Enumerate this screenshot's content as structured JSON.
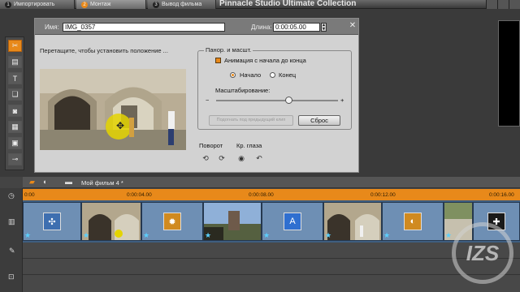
{
  "steps": [
    {
      "num": "1",
      "label": "Импортировать"
    },
    {
      "num": "2",
      "label": "Монтаж"
    },
    {
      "num": "3",
      "label": "Вывод фильма"
    }
  ],
  "app_title": "Pinnacle Studio Ultimate Collection",
  "tools": [
    "scissors-icon",
    "titles-icon",
    "text-icon",
    "effects-icon",
    "camera-icon",
    "clapper-icon",
    "music-icon",
    "plug-icon"
  ],
  "panel": {
    "name_label": "Имя:",
    "name_value": "IMG_0357",
    "duration_label": "Длина:",
    "duration_value": "0:00:05.00",
    "hint": "Перетащите, чтобы установить положение ...",
    "panzoom_title": "Панор. и масшт.",
    "animate_label": "Анимация с начала до конца",
    "animate_checked": true,
    "start_label": "Начало",
    "end_label": "Конец",
    "selected_position": "start",
    "zoom_label": "Масштабирование:",
    "zoom_minus": "−",
    "zoom_plus": "+",
    "zoom_level": 0.58,
    "match_prev_label": "Подогнать под предыдущий клип",
    "reset_label": "Сброс",
    "rotate_label": "Поворот",
    "redeye_label": "Кр. глаза"
  },
  "timeline": {
    "movie_title": "Мой фильм 4 *",
    "ticks": [
      "0:00",
      "0:00:04.00",
      "0:00:08.00",
      "0:00:12.00",
      "0:00:16.00"
    ],
    "clips": [
      {
        "kind": "transition",
        "icon": "✣"
      },
      {
        "kind": "photo"
      },
      {
        "kind": "transition",
        "icon": "✹"
      },
      {
        "kind": "photo"
      },
      {
        "kind": "transition",
        "icon": "A"
      },
      {
        "kind": "photo"
      },
      {
        "kind": "transition",
        "icon": "◐"
      },
      {
        "kind": "photo"
      },
      {
        "kind": "transition",
        "icon": "✚"
      }
    ]
  },
  "colors": {
    "accent": "#e8891a",
    "track": "#3f5e80",
    "panel": "#d2d2d2"
  },
  "watermark": "IZS"
}
